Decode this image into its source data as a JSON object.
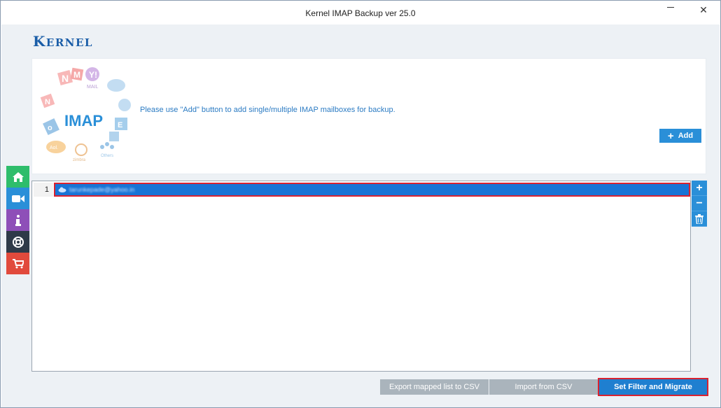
{
  "window": {
    "title": "Kernel IMAP Backup ver 25.0",
    "minimize_icon": "minimize-icon",
    "close_icon": "close-icon",
    "close_glyph": "✕"
  },
  "branding": {
    "logo_text_first": "K",
    "logo_text_rest": "ERNEL"
  },
  "info_panel": {
    "art_label": "IMAP",
    "art_yahoo_label": "MAIL",
    "art_aol_label": "Aol.",
    "art_zimbra_label": "zimbra",
    "art_other_label": "Others",
    "message": "Please use \"Add\" button to add single/multiple IMAP mailboxes for backup.",
    "add_button_label": "Add"
  },
  "side_nav": [
    {
      "name": "home",
      "icon": "home-icon"
    },
    {
      "name": "video",
      "icon": "video-camera-icon"
    },
    {
      "name": "info",
      "icon": "info-icon"
    },
    {
      "name": "help",
      "icon": "lifebuoy-icon"
    },
    {
      "name": "cart",
      "icon": "shopping-cart-icon"
    }
  ],
  "mailbox_list": {
    "rows": [
      {
        "index": "1",
        "email": "tarunkepade@yahoo.in",
        "icon": "cloud-icon",
        "selected": true
      }
    ]
  },
  "list_tools": {
    "add_icon": "plus-icon",
    "remove_icon": "minus-icon",
    "delete_icon": "trash-icon"
  },
  "footer": {
    "export_label": "Export mapped list to CSV",
    "import_label": "Import from CSV",
    "migrate_label": "Set Filter and Migrate"
  },
  "colors": {
    "accent": "#2a8fd8",
    "selection": "#1874d6",
    "highlight_border": "#d92230",
    "logo": "#1b5ea8"
  }
}
